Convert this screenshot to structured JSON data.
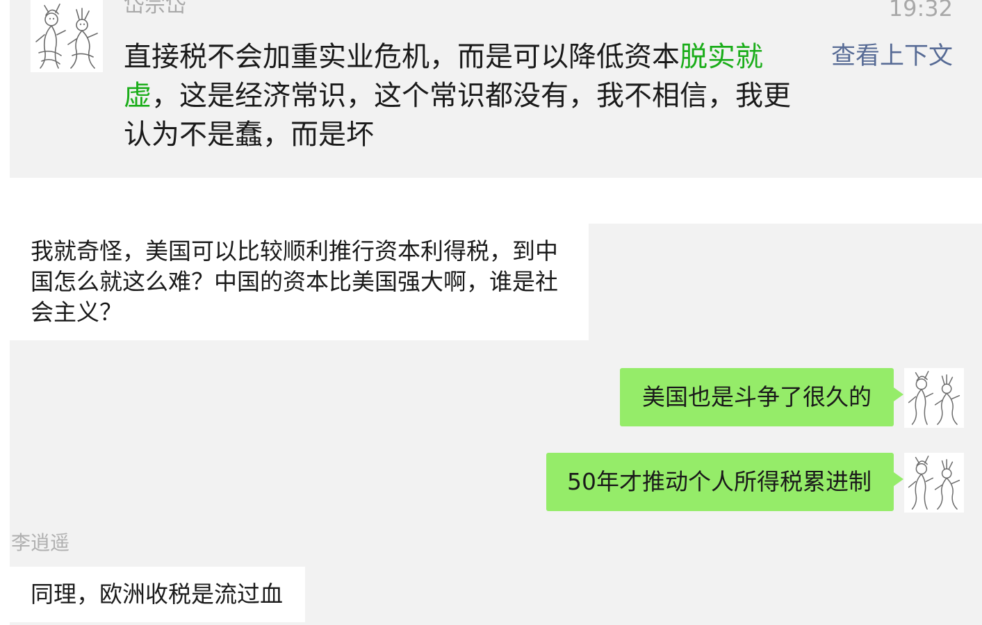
{
  "search_result": {
    "sender": "岱宗岱",
    "time": "19:32",
    "text_before": "直接税不会加重实业危机，而是可以降低资本",
    "text_highlight": "脱实就虚",
    "text_after": "，这是经济常识，这个常识都没有，我不相信，我更认为不是蠢，而是坏",
    "context_link": "查看上下文",
    "avatar_icon": "ink-sketch-avatar-icon",
    "highlight_color": "#1aad19"
  },
  "chat": {
    "messages": [
      {
        "direction": "in",
        "text": "我就奇怪，美国可以比较顺利推行资本利得税，到中国怎么就这么难？中国的资本比美国强大啊，谁是社会主义？"
      },
      {
        "direction": "out",
        "text": "美国也是斗争了很久的"
      },
      {
        "direction": "out",
        "text": "50年才推动个人所得税累进制"
      },
      {
        "direction": "in",
        "sender": "李逍遥",
        "text": "同理，欧洲收税是流过血"
      }
    ],
    "outgoing_bubble_color": "#95ec69",
    "incoming_bubble_color": "#ffffff",
    "background_color": "#f2f2f2",
    "link_color": "#576b95"
  }
}
